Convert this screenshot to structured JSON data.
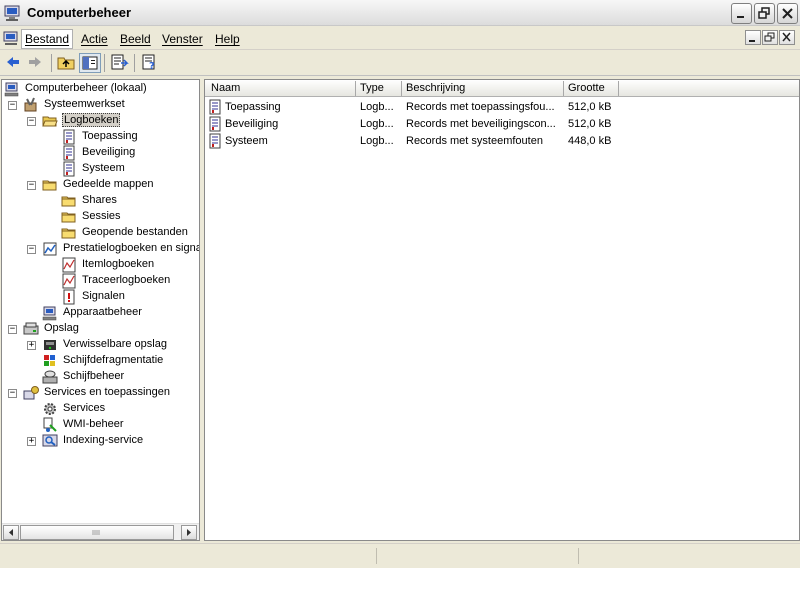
{
  "window": {
    "title": "Computerbeheer"
  },
  "menu": {
    "items": [
      "Bestand",
      "Actie",
      "Beeld",
      "Venster",
      "Help"
    ]
  },
  "tree": {
    "root": "Computerbeheer (lokaal)",
    "nodes": [
      {
        "label": "Systeemwerkset",
        "icon": "tools-icon"
      },
      {
        "label": "Logboeken",
        "icon": "folder-open-icon"
      },
      {
        "label": "Toepassing",
        "icon": "log-icon"
      },
      {
        "label": "Beveiliging",
        "icon": "log-icon"
      },
      {
        "label": "Systeem",
        "icon": "log-icon"
      },
      {
        "label": "Gedeelde mappen",
        "icon": "folder-icon"
      },
      {
        "label": "Shares",
        "icon": "folder-icon"
      },
      {
        "label": "Sessies",
        "icon": "folder-icon"
      },
      {
        "label": "Geopende bestanden",
        "icon": "folder-icon"
      },
      {
        "label": "Prestatielogboeken en signal",
        "icon": "performance-icon"
      },
      {
        "label": "Itemlogboeken",
        "icon": "chart-log-icon"
      },
      {
        "label": "Traceerlogboeken",
        "icon": "chart-log-icon"
      },
      {
        "label": "Signalen",
        "icon": "alert-icon"
      },
      {
        "label": "Apparaatbeheer",
        "icon": "computer-icon"
      },
      {
        "label": "Opslag",
        "icon": "storage-icon"
      },
      {
        "label": "Verwisselbare opslag",
        "icon": "removable-storage-icon"
      },
      {
        "label": "Schijfdefragmentatie",
        "icon": "defrag-icon"
      },
      {
        "label": "Schijfbeheer",
        "icon": "disk-icon"
      },
      {
        "label": "Services en toepassingen",
        "icon": "services-icon"
      },
      {
        "label": "Services",
        "icon": "gear-icon"
      },
      {
        "label": "WMI-beheer",
        "icon": "wmi-icon"
      },
      {
        "label": "Indexing-service",
        "icon": "indexing-icon"
      }
    ]
  },
  "list": {
    "columns": [
      "Naam",
      "Type",
      "Beschrijving",
      "Grootte"
    ],
    "rows": [
      {
        "name": "Toepassing",
        "type": "Logb...",
        "description": "Records met toepassingsfou...",
        "size": "512,0 kB"
      },
      {
        "name": "Beveiliging",
        "type": "Logb...",
        "description": "Records met beveiligingscon...",
        "size": "512,0 kB"
      },
      {
        "name": "Systeem",
        "type": "Logb...",
        "description": "Records met systeemfouten",
        "size": "448,0 kB"
      }
    ]
  },
  "colors": {
    "selection": "#d4d0c8",
    "chrome": "#ece9d8"
  }
}
